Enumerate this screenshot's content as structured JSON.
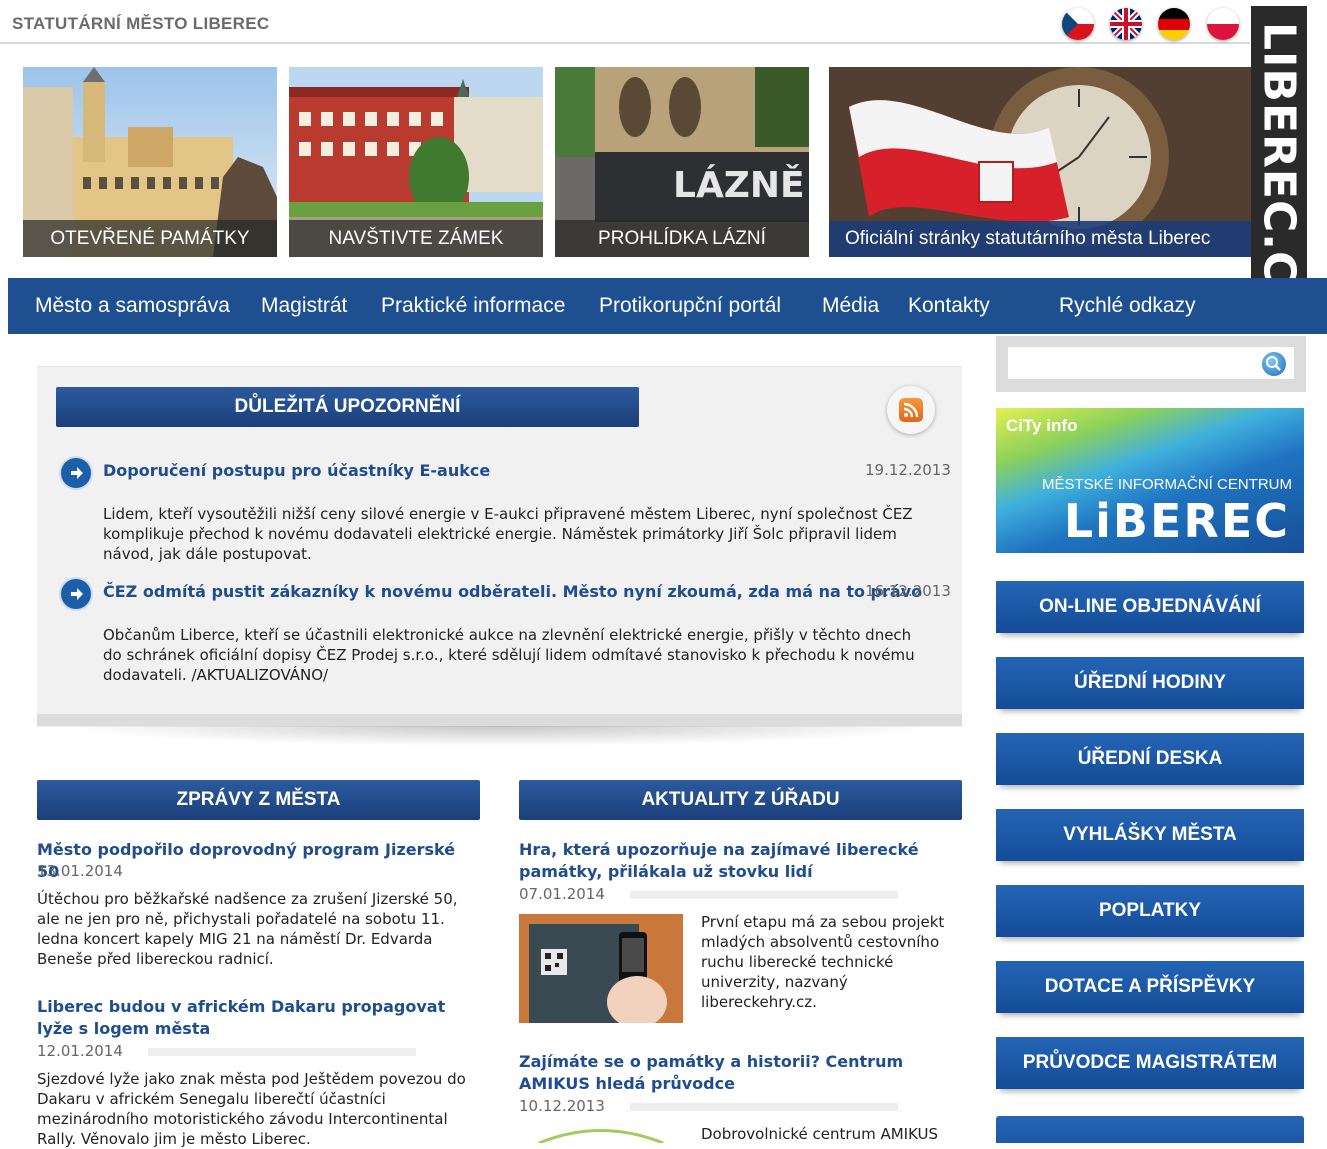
{
  "header": {
    "site_name": "STATUTÁRNÍ MĚSTO LIBEREC",
    "vertical_logo": "LIBEREC.CZ",
    "flags": [
      "czech-flag-icon",
      "uk-flag-icon",
      "german-flag-icon",
      "polish-flag-icon"
    ]
  },
  "banners": [
    {
      "label": "OTEVŘENÉ PAMÁTKY"
    },
    {
      "label": "NAVŠTIVTE ZÁMEK"
    },
    {
      "label": "PROHLÍDKA LÁZNÍ"
    }
  ],
  "hero": {
    "caption": "Oficiální stránky statutárního města Liberec",
    "lazne_sign": "LÁZNĚ"
  },
  "nav": {
    "items": [
      "Město a samospráva",
      "Magistrát",
      "Praktické informace",
      "Protikorupční portál",
      "Média",
      "Kontakty",
      "Rychlé odkazy"
    ]
  },
  "search": {
    "placeholder": ""
  },
  "warnings": {
    "title": "DŮLEŽITÁ UPOZORNĚNÍ",
    "items": [
      {
        "title": "Doporučení postupu pro účastníky E-aukce",
        "date": "19.12.2013",
        "text": "Lidem, kteří vysoutěžili nižší ceny silové energie v E-aukci připravené městem Liberec, nyní společnost ČEZ komplikuje přechod k novému dodavateli elektrické energie. Náměstek primátorky Jiří Šolc připravil lidem návod, jak dále postupovat."
      },
      {
        "title": "ČEZ odmítá pustit zákazníky k novému odběrateli. Město nyní zkoumá, zda má na to právo",
        "date": "16.12.2013",
        "text": "Občanům Liberce, kteří se účastnili elektronické aukce na zlevnění elektrické energie, přišly v těchto dnech do schránek oficiální dopisy ČEZ Prodej s.r.o., které sdělují lidem odmítavé stanovisko k přechodu k novému dodavateli. /AKTUALIZOVÁNO/"
      }
    ]
  },
  "city_news": {
    "title": "ZPRÁVY Z MĚSTA",
    "items": [
      {
        "title": "Město podpořilo doprovodný program Jizerské 50",
        "date": "13.01.2014",
        "text": "Útěchou pro běžkařské nadšence za zrušení Jizerské 50, ale ne jen pro ně, přichystali pořadatelé na sobotu 11. ledna koncert kapely MIG 21 na náměstí Dr. Edvarda Beneše před libereckou radnicí."
      },
      {
        "title": "Liberec budou v africkém Dakaru propagovat lyže s logem města",
        "date": "12.01.2014",
        "text": "Sjezdové lyže jako znak města pod Ještědem povezou do Dakaru v africkém Senegalu liberečtí účastníci mezinárodního motoristického závodu Intercontinental Rally. Věnovalo jim je město Liberec."
      }
    ]
  },
  "office_news": {
    "title": "AKTUALITY Z ÚŘADU",
    "items": [
      {
        "title": "Hra, která upozorňuje na zajímavé liberecké památky, přilákala už stovku lidí",
        "date": "07.01.2014",
        "text": "První etapu má za sebou projekt mladých absolventů cestovního ruchu liberecké technické univerzity, nazvaný libereckehry.cz."
      },
      {
        "title": "Zajímáte se o památky a historii? Centrum AMIKUS hledá průvodce",
        "date": "10.12.2013",
        "text": "Dobrovolnické centrum AMIKUS"
      }
    ]
  },
  "city_info": {
    "tag": "CiTy info",
    "subtitle": "MĚSTSKÉ INFORMAČNÍ CENTRUM",
    "name": "LiBEREC"
  },
  "side_buttons": [
    "ON-LINE OBJEDNÁVÁNÍ",
    "ÚŘEDNÍ HODINY",
    "ÚŘEDNÍ DESKA",
    "VYHLÁŠKY MĚSTA",
    "POPLATKY",
    "DOTACE A PŘÍSPĚVKY",
    "PRŮVODCE MAGISTRÁTEM"
  ],
  "colors": {
    "nav_blue": "#1d4f91",
    "link_blue": "#1f4d8f",
    "button_blue": "#2565b5"
  }
}
